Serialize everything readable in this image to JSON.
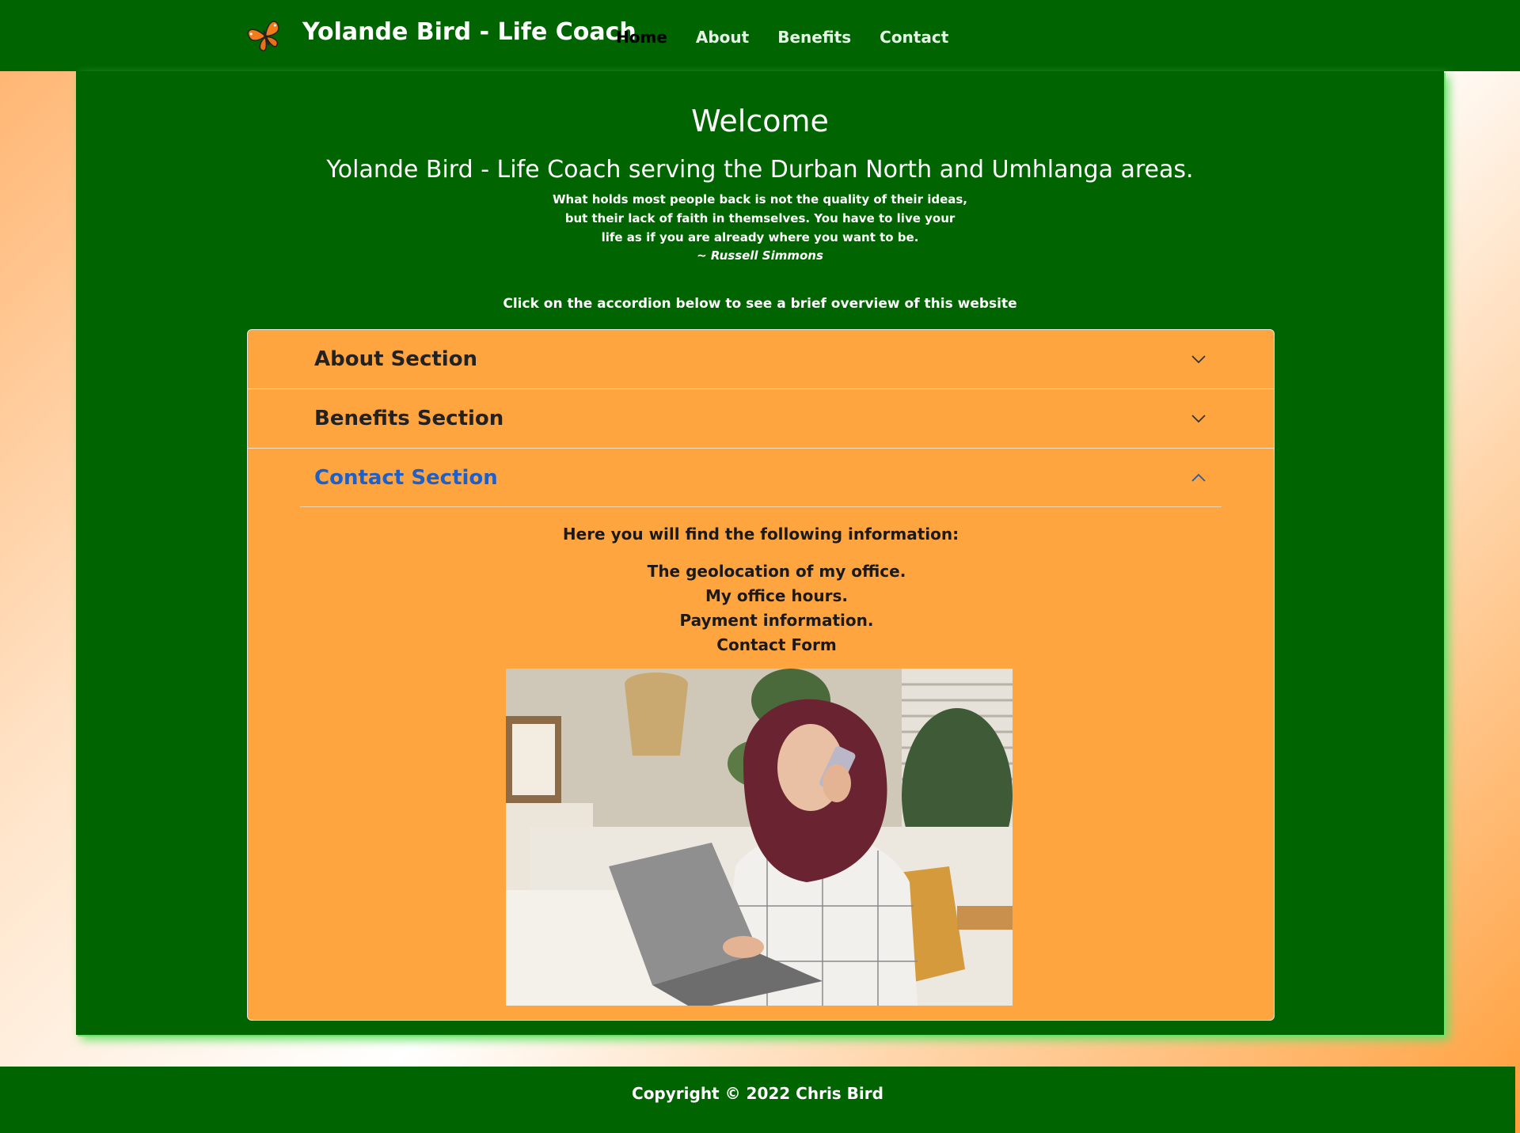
{
  "header": {
    "brand": "Yolande Bird - Life Coach",
    "logo_icon": "butterfly-icon",
    "nav": [
      {
        "label": "Home",
        "active": true
      },
      {
        "label": "About",
        "active": false
      },
      {
        "label": "Benefits",
        "active": false
      },
      {
        "label": "Contact",
        "active": false
      }
    ]
  },
  "hero": {
    "welcome": "Welcome",
    "subtitle": "Yolande Bird - Life Coach serving the Durban North and Umhlanga areas.",
    "quote_lines": [
      "What holds most people back is not the quality of their ideas,",
      "but their lack of faith in themselves. You have to live your",
      "life as if you are already where you want to be."
    ],
    "quote_author": "~ Russell Simmons",
    "instruction": "Click on the accordion below to see a brief overview of this website"
  },
  "accordion": {
    "items": [
      {
        "title": "About Section",
        "expanded": false,
        "icon": "chevron-down-icon"
      },
      {
        "title": "Benefits Section",
        "expanded": false,
        "icon": "chevron-down-icon"
      },
      {
        "title": "Contact Section",
        "expanded": true,
        "icon": "chevron-up-icon"
      }
    ],
    "open_body": {
      "intro": "Here you will find the following information:",
      "list": [
        "The geolocation of my office.",
        "My office hours.",
        "Payment information.",
        "Contact Form"
      ],
      "image": "woman-on-phone-with-laptop-photo"
    }
  },
  "footer": {
    "copyright": "Copyright © 2022 Chris Bird"
  },
  "colors": {
    "nav_bg": "#006400",
    "accordion_bg": "#ffa540",
    "active_link": "#000000",
    "open_title": "#1e60c8"
  }
}
